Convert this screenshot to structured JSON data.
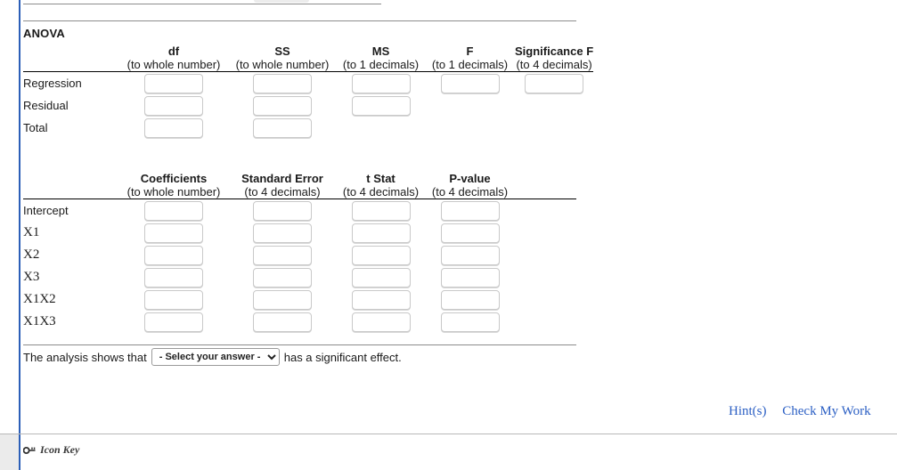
{
  "anova": {
    "title": "ANOVA",
    "columns": [
      {
        "label": "df",
        "precision_prefix": "(to ",
        "precision_value": "whole number",
        "precision_suffix": ")",
        "precision_text": "(to whole number)"
      },
      {
        "label": "SS",
        "precision_text": "(to whole number)"
      },
      {
        "label": "MS",
        "precision_text": "(to 1 decimals)",
        "precision_num": "1"
      },
      {
        "label": "F",
        "precision_text": "(to 1 decimals)",
        "precision_num": "1"
      },
      {
        "label": "Significance F",
        "precision_text": "(to 4 decimals)",
        "precision_num": "4"
      }
    ],
    "rows": [
      {
        "label": "Regression",
        "cells": [
          "",
          "",
          "",
          "",
          ""
        ]
      },
      {
        "label": "Residual",
        "cells": [
          "",
          "",
          "",
          null,
          null
        ]
      },
      {
        "label": "Total",
        "cells": [
          "",
          "",
          null,
          null,
          null
        ]
      }
    ]
  },
  "coefficients": {
    "columns": [
      {
        "label": "Coefficients",
        "precision_text": "(to whole number)"
      },
      {
        "label": "Standard Error",
        "precision_text": "(to 4 decimals)",
        "precision_num": "4"
      },
      {
        "label": "t Stat",
        "precision_text": "(to 4 decimals)",
        "precision_num": "4"
      },
      {
        "label": "P-value",
        "precision_text": "(to 4 decimals)",
        "precision_num": "4"
      }
    ],
    "rows": [
      {
        "label": "Intercept",
        "serif": false,
        "cells": [
          "",
          "",
          "",
          ""
        ]
      },
      {
        "label": "X1",
        "serif": true,
        "cells": [
          "",
          "",
          "",
          ""
        ]
      },
      {
        "label": "X2",
        "serif": true,
        "cells": [
          "",
          "",
          "",
          ""
        ]
      },
      {
        "label": "X3",
        "serif": true,
        "cells": [
          "",
          "",
          "",
          ""
        ]
      },
      {
        "label": "X1X2",
        "serif": true,
        "cells": [
          "",
          "",
          "",
          ""
        ]
      },
      {
        "label": "X1X3",
        "serif": true,
        "cells": [
          "",
          "",
          "",
          ""
        ]
      }
    ]
  },
  "conclusion": {
    "prefix": "The analysis shows that",
    "select_value": "- Select your answer -",
    "suffix": "has a significant effect."
  },
  "actions": {
    "hints_label": "Hint(s)",
    "check_label": "Check My Work"
  },
  "footer": {
    "icon_key_label": "Icon Key"
  },
  "colors": {
    "accent_rail": "#2c5fb8",
    "link": "#2b5fc4",
    "input_border": "#c9c9c9",
    "rule": "#8c8c8c",
    "footer_rule": "#b8b8b8",
    "footer_gutter": "#ebebeb"
  }
}
